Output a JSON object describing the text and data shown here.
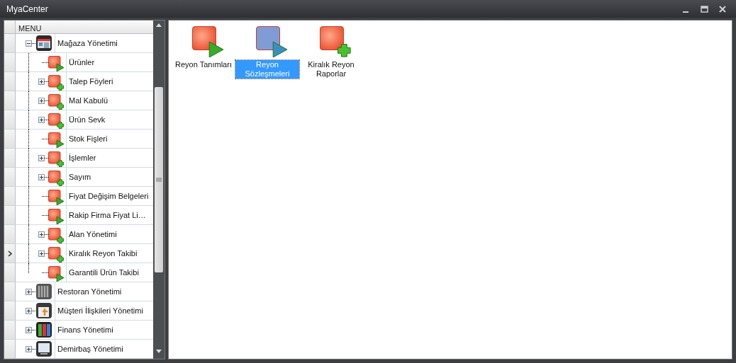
{
  "window": {
    "title": "MyaCenter"
  },
  "tree": {
    "header": "MENU",
    "nodes": [
      {
        "label": "Mağaza Yönetimi",
        "kind": "store",
        "expanded": true,
        "current": false,
        "children": [
          {
            "label": "Ürünler",
            "kind": "play",
            "current": false
          },
          {
            "label": "Talep Föyleri",
            "kind": "plus",
            "expanded": false,
            "current": false
          },
          {
            "label": "Mal Kabulü",
            "kind": "plus",
            "expanded": false,
            "current": false
          },
          {
            "label": "Ürün Sevk",
            "kind": "plus",
            "expanded": false,
            "current": false
          },
          {
            "label": "Stok Fişleri",
            "kind": "play",
            "current": false
          },
          {
            "label": "İşlemler",
            "kind": "plus",
            "expanded": false,
            "current": false
          },
          {
            "label": "Sayım",
            "kind": "plus",
            "expanded": false,
            "current": false
          },
          {
            "label": "Fiyat Değişim Belgeleri",
            "kind": "play",
            "current": false
          },
          {
            "label": "Rakip Firma Fiyat Li…",
            "kind": "play",
            "current": false
          },
          {
            "label": "Alan Yönetimi",
            "kind": "plus",
            "expanded": false,
            "current": false
          },
          {
            "label": "Kiralık Reyon Takibi",
            "kind": "plus",
            "expanded": false,
            "current": true
          },
          {
            "label": "Garantili Ürün Takibi",
            "kind": "play",
            "current": false
          }
        ]
      },
      {
        "label": "Restoran Yönetimi",
        "kind": "restaurant",
        "expanded": false,
        "current": false
      },
      {
        "label": "Müşteri İlişkileri Yönetimi",
        "kind": "gift",
        "expanded": false,
        "current": false
      },
      {
        "label": "Finans Yönetimi",
        "kind": "binders",
        "expanded": false,
        "current": false
      },
      {
        "label": "Demirbaş Yönetimi",
        "kind": "monitor",
        "expanded": false,
        "current": false
      }
    ]
  },
  "tiles": [
    {
      "label": "Reyon Tanımları",
      "kind": "play",
      "selected": false
    },
    {
      "label": "Reyon Sözleşmeleri",
      "kind": "play",
      "selected": true
    },
    {
      "label": "Kiralık Reyon Raporlar",
      "kind": "plus",
      "selected": false
    }
  ]
}
